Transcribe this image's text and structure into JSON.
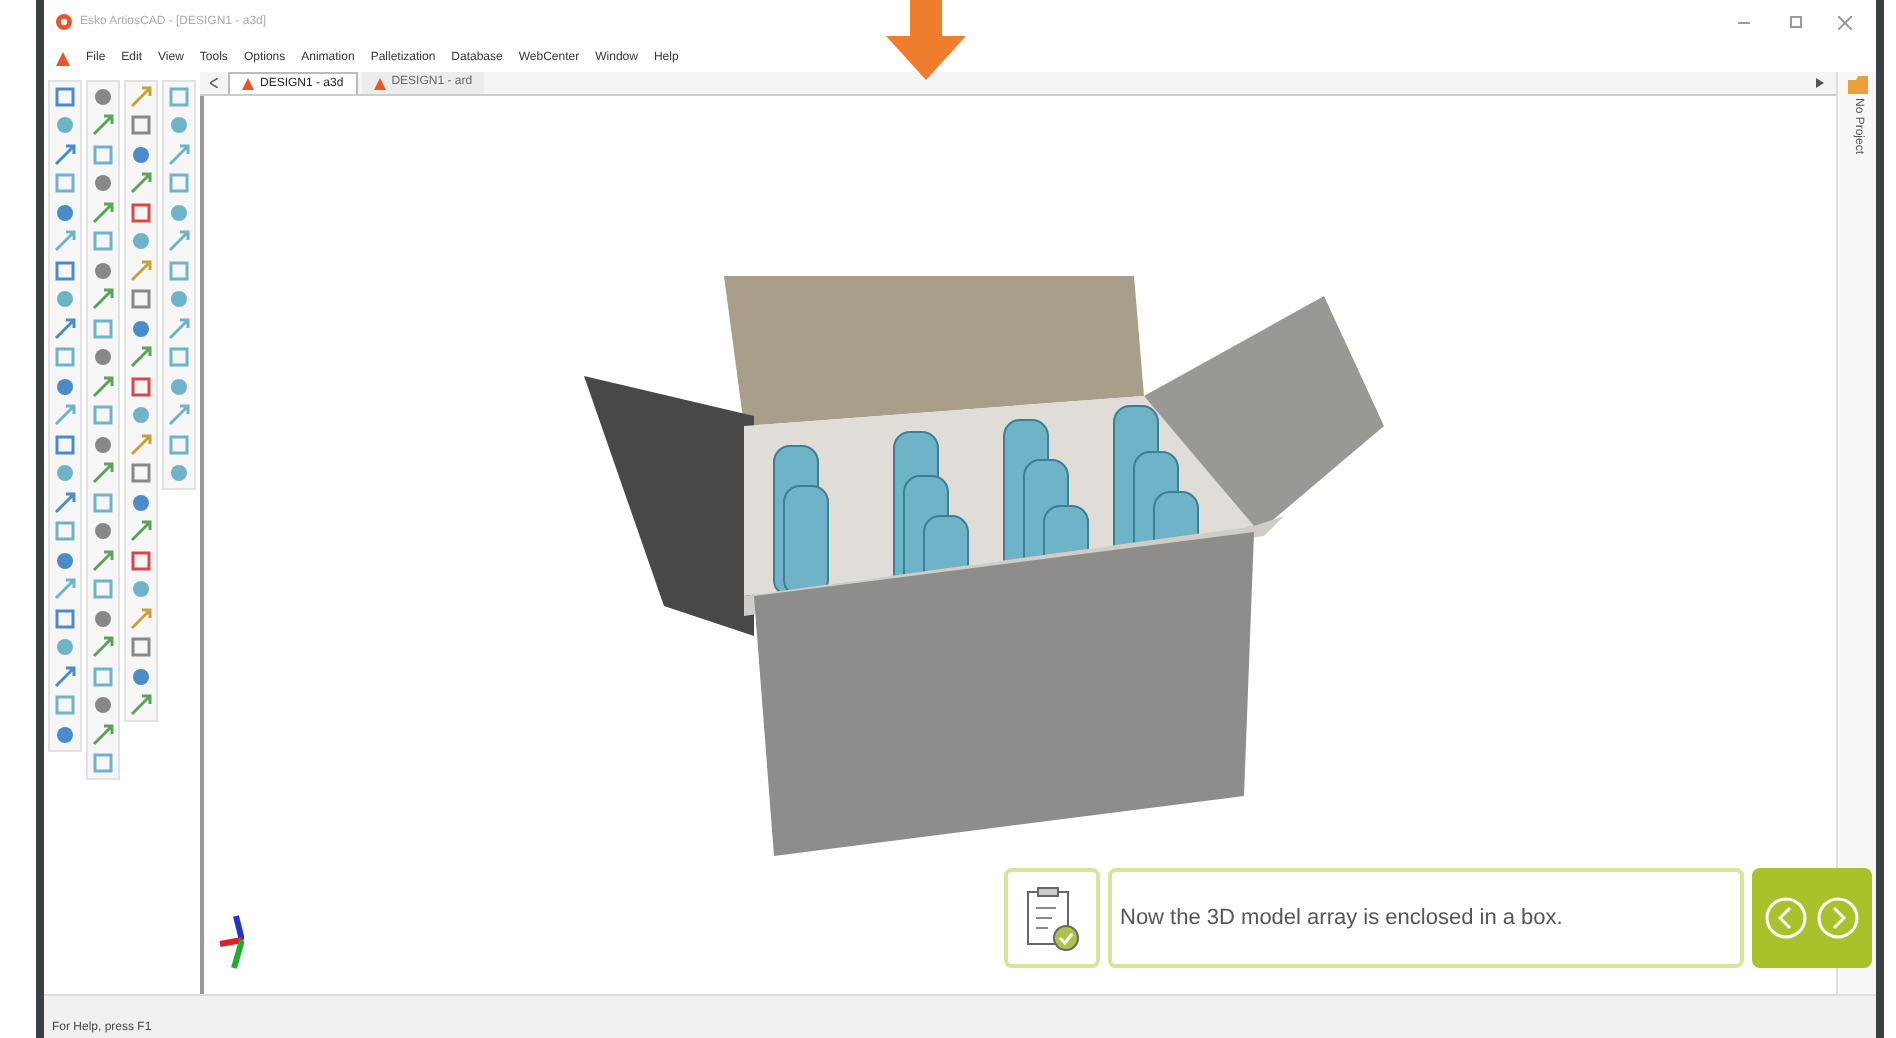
{
  "window": {
    "title": "Esko ArtiosCAD - [DESIGN1 - a3d]"
  },
  "menu": [
    "File",
    "Edit",
    "View",
    "Tools",
    "Options",
    "Animation",
    "Palletization",
    "Database",
    "WebCenter",
    "Window",
    "Help"
  ],
  "tabs": [
    {
      "label": "DESIGN1 - a3d",
      "selected": true
    },
    {
      "label": "DESIGN1 - ard",
      "selected": false
    }
  ],
  "side_panel": {
    "label": "No Project"
  },
  "tutorial": {
    "message": "Now the 3D model array is enclosed in a box."
  },
  "status_bar": {
    "text": "For Help, press F1"
  }
}
